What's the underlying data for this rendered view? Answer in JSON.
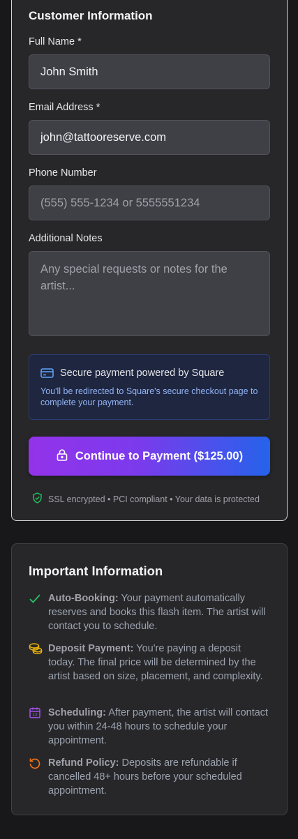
{
  "form": {
    "section_title": "Customer Information",
    "full_name_label": "Full Name *",
    "full_name_value": "John Smith",
    "email_label": "Email Address *",
    "email_value": "john@tattooreserve.com",
    "phone_label": "Phone Number",
    "phone_placeholder": "(555) 555-1234 or 5555551234",
    "notes_label": "Additional Notes",
    "notes_placeholder": "Any special requests or notes for the artist..."
  },
  "payment": {
    "secure_title": "Secure payment powered by Square",
    "secure_text": "You'll be redirected to Square's secure checkout page to complete your payment.",
    "button_label": "Continue to Payment ($125.00)",
    "ssl_text": "SSL encrypted • PCI compliant • Your data is protected"
  },
  "info": {
    "title": "Important Information",
    "items": [
      {
        "icon": "check-icon",
        "heading": "Auto-Booking:",
        "text": " Your payment automatically reserves and books this flash item. The artist will contact you to schedule."
      },
      {
        "icon": "coins-icon",
        "heading": "Deposit Payment:",
        "text": " You're paying a deposit today. The final price will be determined by the artist based on size, placement, and complexity."
      },
      {
        "icon": "calendar-icon",
        "heading": "Scheduling:",
        "text": " After payment, the artist will contact you within 24-48 hours to schedule your appointment."
      },
      {
        "icon": "refund-icon",
        "heading": "Refund Policy:",
        "text": " Deposits are refundable if cancelled 48+ hours before your scheduled appointment."
      }
    ]
  },
  "colors": {
    "background": "#18181b",
    "card": "#27272a",
    "accent_purple": "#9333ea",
    "accent_blue": "#2563eb",
    "check_green": "#22c55e",
    "coin_yellow": "#eab308",
    "calendar_purple": "#a855f7",
    "refund_orange": "#f97316"
  }
}
